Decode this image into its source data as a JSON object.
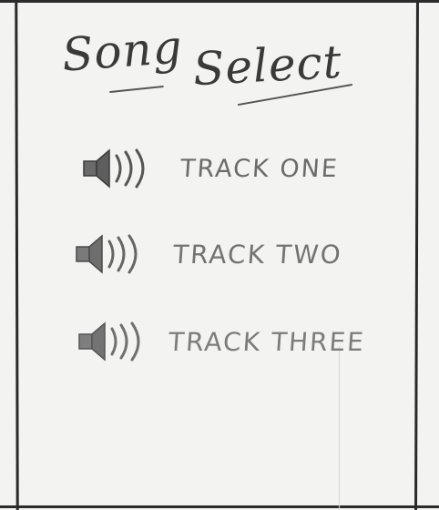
{
  "title": {
    "word1": "Song",
    "word2": "Select"
  },
  "tracks": [
    {
      "label": "TRACK ONE",
      "icon": "speaker-icon"
    },
    {
      "label": "TRACK TWO",
      "icon": "speaker-icon"
    },
    {
      "label": "TRACK THREE",
      "icon": "speaker-icon"
    }
  ],
  "colors": {
    "frame": "#2a2a2a",
    "paper": "#f3f3f1",
    "pencil_dark": "#3a3a3a",
    "pencil_light": "#6b6b6b"
  }
}
